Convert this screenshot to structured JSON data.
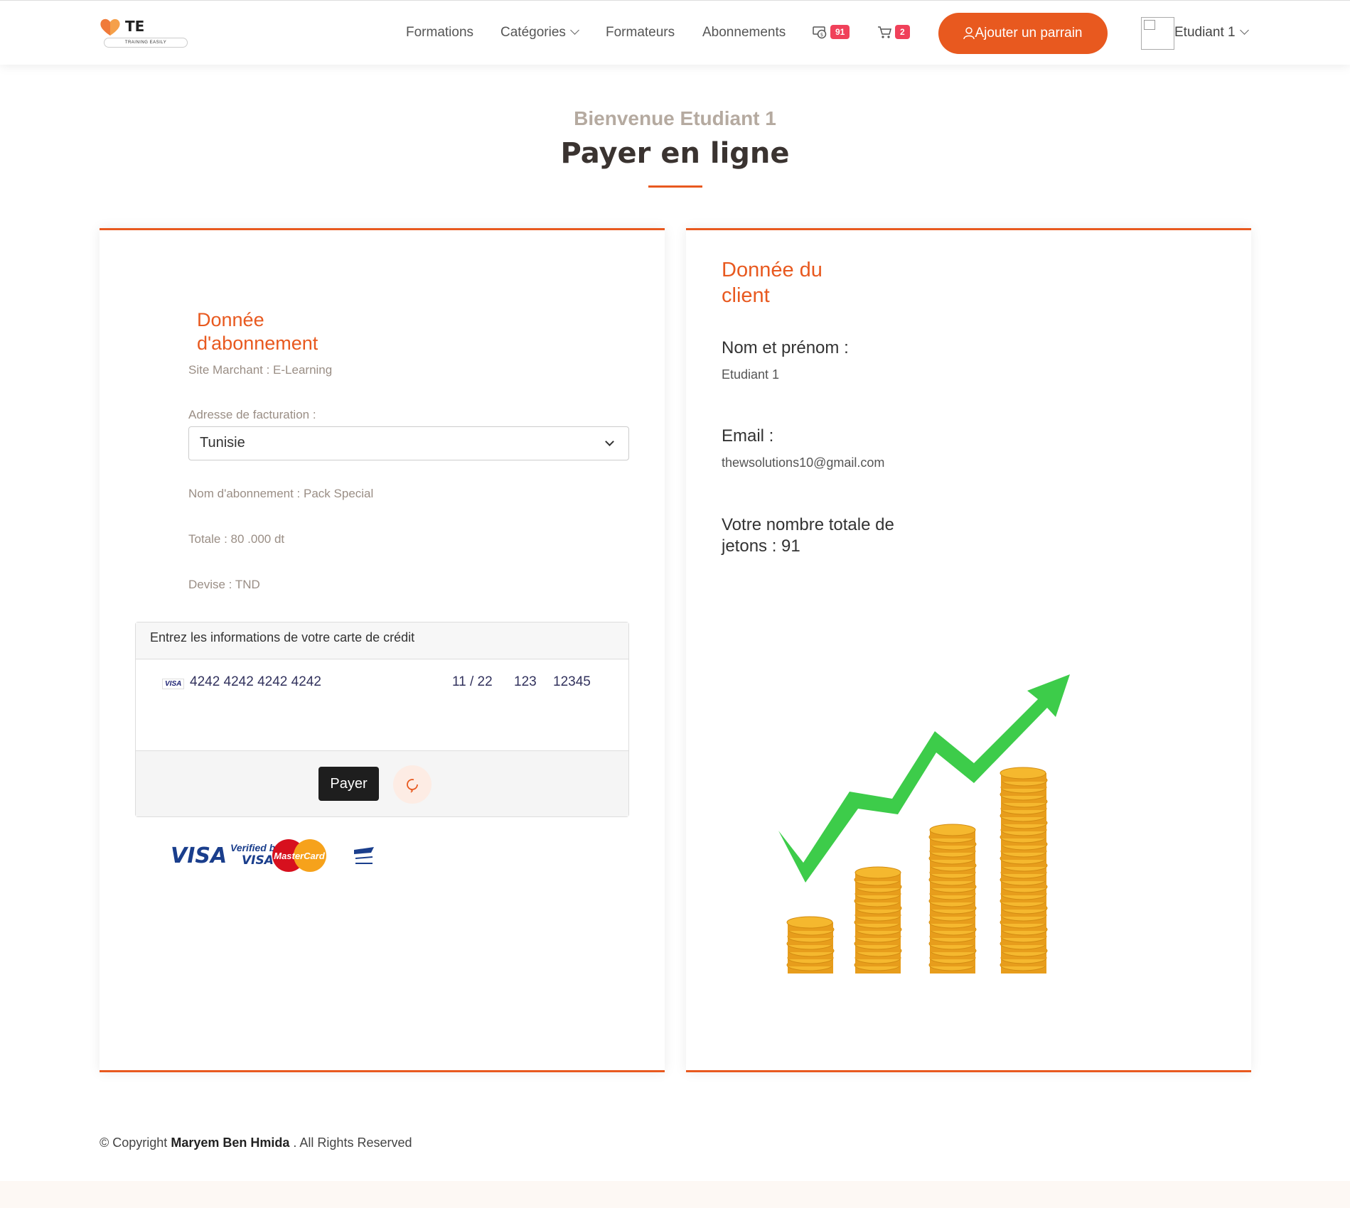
{
  "header": {
    "logo_text": "TE",
    "logo_sub": "TRAINING EASILY",
    "nav": {
      "formations": "Formations",
      "categories": "Catégories",
      "formateurs": "Formateurs",
      "abonnements": "Abonnements"
    },
    "tokens_badge": "91",
    "cart_badge": "2",
    "parrain_button": "Ajouter un parrain",
    "user_name": "Etudiant 1"
  },
  "hero": {
    "welcome": "Bienvenue Etudiant 1",
    "title": "Payer en ligne"
  },
  "subscription": {
    "heading_line1": "Donnée",
    "heading_line2": "d'abonnement",
    "merchant": "Site Marchant : E-Learning",
    "billing_label": "Adresse de facturation :",
    "billing_value": "Tunisie",
    "plan": "Nom d'abonnement : Pack Special",
    "total": "Totale : 80 .000 dt",
    "currency": "Devise : TND"
  },
  "card_form": {
    "header": "Entrez les informations de votre carte de crédit",
    "brand": "VISA",
    "number": "4242 4242 4242 4242",
    "expiry": "11 / 22",
    "cvc": "123",
    "zip": "12345",
    "pay_button": "Payer"
  },
  "payment_logos": {
    "visa": "VISA",
    "verified_line1": "Verified by",
    "verified_line2": "VISA",
    "mastercard": "MasterCard"
  },
  "client": {
    "heading_line1": "Donnée du",
    "heading_line2": "client",
    "name_label": "Nom et prénom :",
    "name_value": "Etudiant 1",
    "email_label": "Email :",
    "email_value": "thewsolutions10@gmail.com",
    "tokens_line1": "Votre nombre totale de",
    "tokens_line2": "jetons : 91"
  },
  "footer": {
    "prefix": "© Copyright",
    "author": "Maryem Ben Hmida",
    "suffix": ". All Rights Reserved"
  },
  "colors": {
    "accent": "#e8591f",
    "badge": "#f0415a",
    "dark_button": "#1e1e1e",
    "chart_arrow": "#3dcc4a",
    "coin": "#f5b82e"
  }
}
